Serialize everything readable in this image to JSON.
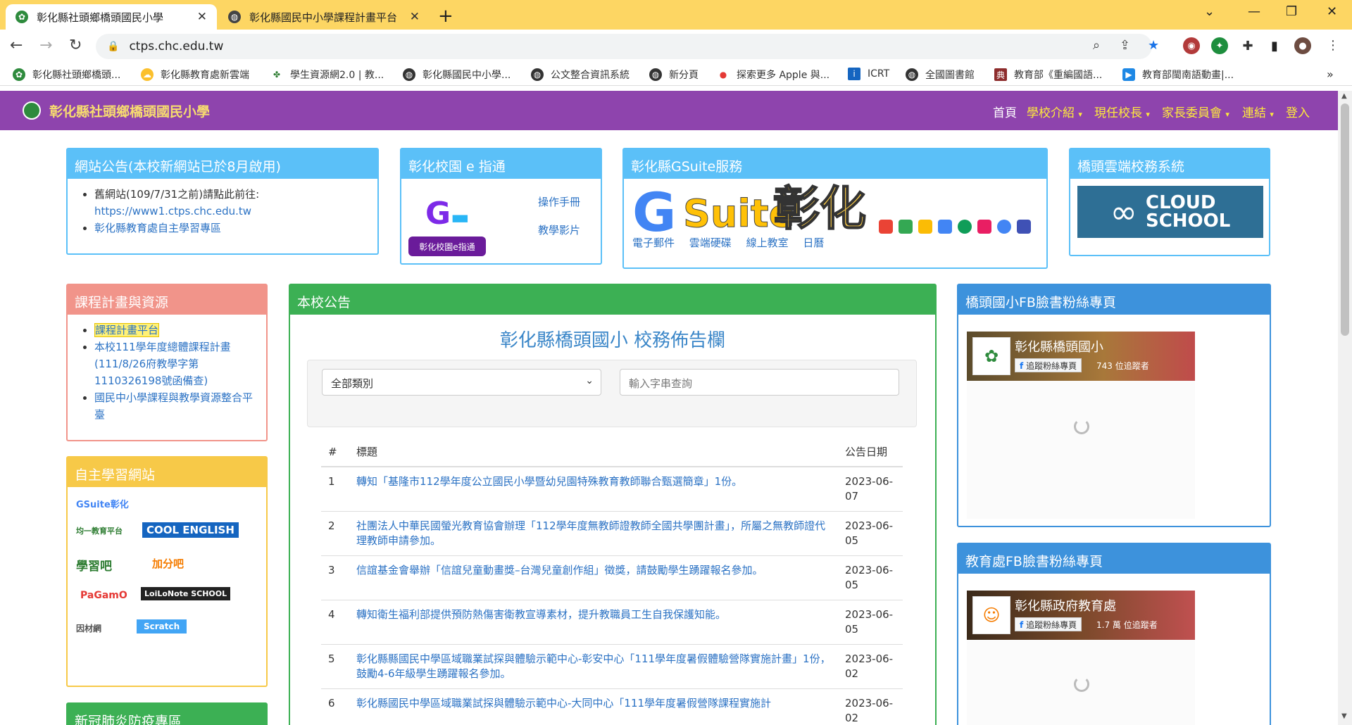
{
  "browser": {
    "tabs": [
      {
        "title": "彰化縣社頭鄉橋頭國民小學",
        "active": true
      },
      {
        "title": "彰化縣國民中小學課程計畫平台",
        "active": false
      }
    ],
    "url": "ctps.chc.edu.tw",
    "bookmarks": [
      "彰化縣社頭鄉橋頭...",
      "彰化縣教育處新雲端",
      "學生資源網2.0 | 教...",
      "彰化縣國民中小學...",
      "公文整合資訊系統",
      "新分頁",
      "探索更多 Apple 與...",
      "ICRT",
      "全國圖書館",
      "教育部《重編國語...",
      "教育部閩南語動畫|..."
    ]
  },
  "site": {
    "title": "彰化縣社頭鄉橋頭國民小學",
    "menu": [
      "首頁",
      "學校介紹",
      "現任校長",
      "家長委員會",
      "連結",
      "登入"
    ]
  },
  "panels": {
    "notice": {
      "title": "網站公告(本校新網站已於8月啟用)",
      "item1_text": "舊網站(109/7/31之前)請點此前往:",
      "item1_link": "https://www1.ctps.chc.edu.tw",
      "item2_link": "彰化縣教育處自主學習專區"
    },
    "ecampus": {
      "title": "彰化校園 e 指通",
      "badge": "彰化校園e指通",
      "links": [
        "操作手冊",
        "教學影片"
      ]
    },
    "gsuite": {
      "title": "彰化縣GSuite服務",
      "logo_word": "Suite",
      "logo_zh": "彰化",
      "links": [
        "電子郵件",
        "雲端硬碟",
        "線上教室",
        "日曆"
      ]
    },
    "cloud": {
      "title": "橋頭雲端校務系統",
      "line1": "CLOUD",
      "line2": "SCHOOL"
    },
    "curriculum": {
      "title": "課程計畫與資源",
      "links": [
        "課程計畫平台",
        "本校111學年度總體課程計畫(111/8/26府教學字第1110326198號函備查)",
        "國民中小學課程與教學資源整合平臺"
      ]
    },
    "selflearn": {
      "title": "自主學習網站",
      "logos": [
        "GSuite彰化",
        "均一教育平台",
        "COOL ENGLISH",
        "學習吧",
        "加分吧",
        "PaGamO",
        "LoiLoNote SCHOOL",
        "因材網",
        "Scratch"
      ]
    },
    "covid": {
      "title": "新冠肺炎防疫專區"
    },
    "announcements": {
      "header": "本校公告",
      "title": "彰化縣橋頭國小 校務佈告欄",
      "category_select": "全部類別",
      "search_placeholder": "輸入字串查詢",
      "col_num": "#",
      "col_title": "標題",
      "col_date": "公告日期",
      "rows": [
        {
          "n": "1",
          "title": "轉知「基隆市112學年度公立國民小學暨幼兒園特殊教育教師聯合甄選簡章」1份。",
          "date": "2023-06-07"
        },
        {
          "n": "2",
          "title": "社團法人中華民國螢光教育協會辦理「112學年度無教師證教師全國共學團計畫」，所屬之無教師證代理教師申請參加。",
          "date": "2023-06-05"
        },
        {
          "n": "3",
          "title": "信誼基金會舉辦「信誼兒童動畫獎–台灣兒童創作組」徵獎，請鼓勵學生踴躍報名參加。",
          "date": "2023-06-05"
        },
        {
          "n": "4",
          "title": "轉知衛生福利部提供預防熱傷害衛教宣導素材，提升教職員工生自我保護知能。",
          "date": "2023-06-05"
        },
        {
          "n": "5",
          "title": "彰化縣縣國民中學區域職業試探與體驗示範中心-彰安中心「111學年度暑假體驗營隊實施計畫」1份，鼓勵4-6年級學生踴躍報名參加。",
          "date": "2023-06-02"
        },
        {
          "n": "6",
          "title": "彰化縣國民中學區域職業試探與體驗示範中心-大同中心「111學年度暑假營隊課程實施計",
          "date": "2023-06-02"
        }
      ]
    },
    "fb_school": {
      "title": "橋頭國小FB臉書粉絲專頁",
      "name": "彰化縣橋頭國小",
      "follow": "追蹤粉絲專頁",
      "count": "743 位追蹤者"
    },
    "fb_edu": {
      "title": "教育處FB臉書粉絲專頁",
      "name": "彰化縣政府教育處",
      "follow": "追蹤粉絲專頁",
      "count": "1.7 萬 位追蹤者"
    }
  },
  "colors": {
    "tabstrip": "#fdd663",
    "site_nav": "#8e44ad",
    "link": "#2b72c4"
  }
}
